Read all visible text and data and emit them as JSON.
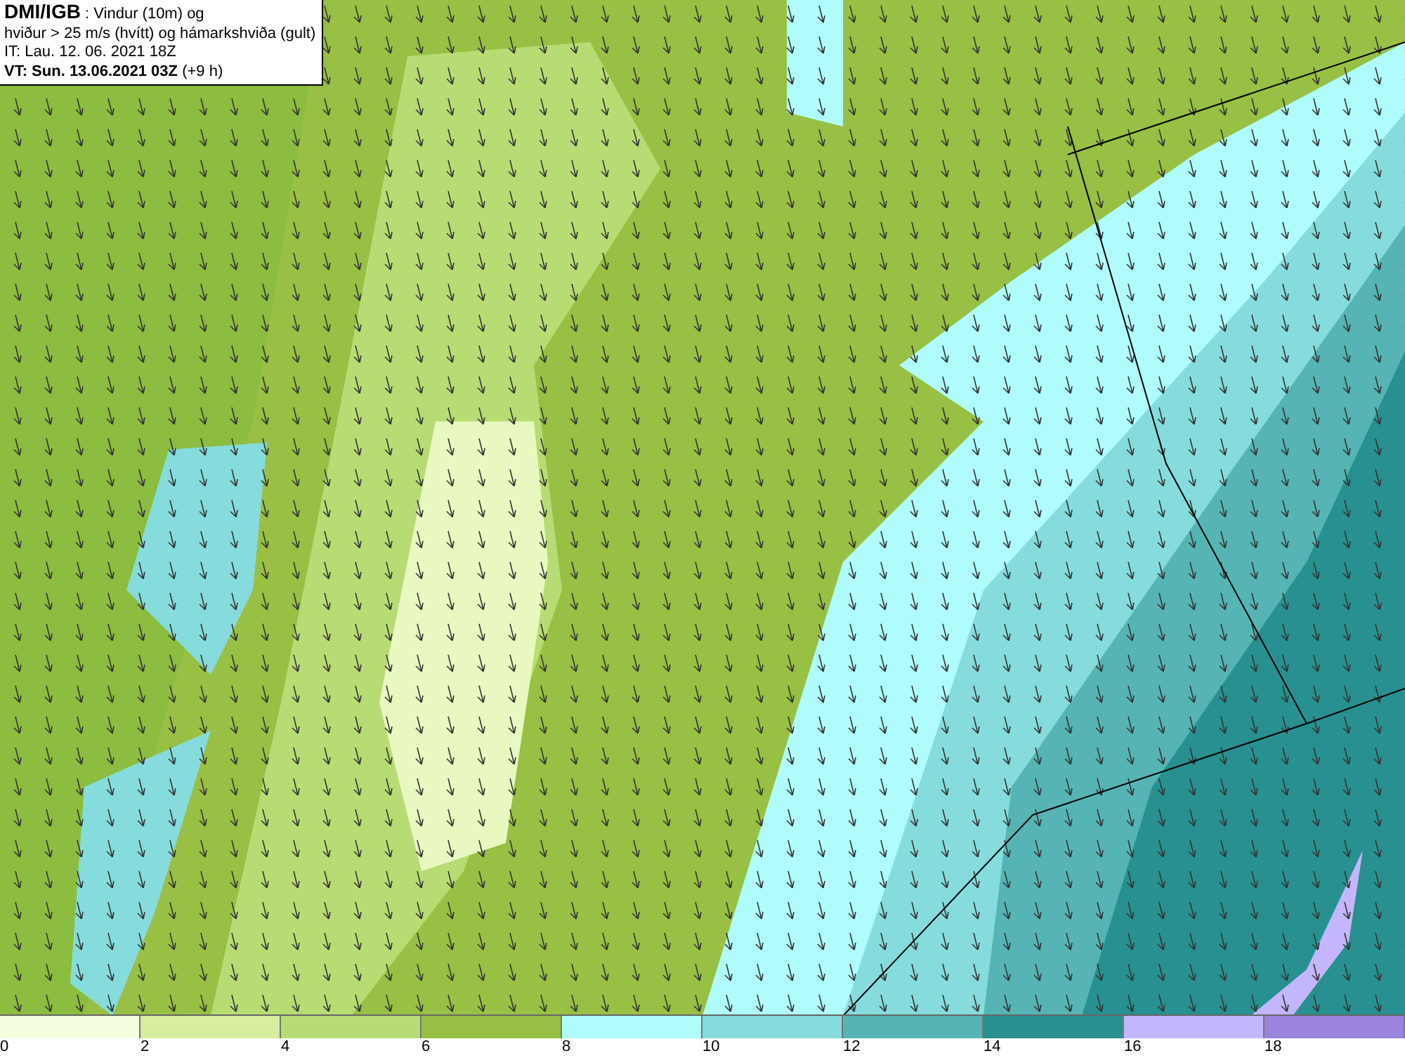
{
  "title_box": {
    "source": "DMI/IGB",
    "description": ": Vindur (10m) og",
    "line_2": "hviður > 25 m/s (hvítt) og hámarkshviða (gult)",
    "issue_time": "IT: Lau. 12. 06. 2021 18Z",
    "valid_time": "VT: Sun. 13.06.2021 03Z",
    "lead": "(+9 h)"
  },
  "legend": {
    "bins": [
      {
        "label": "0",
        "color": "#f4fde0"
      },
      {
        "label": "2",
        "color": "#d6ee9e"
      },
      {
        "label": "4",
        "color": "#b8dc74"
      },
      {
        "label": "6",
        "color": "#98c044"
      },
      {
        "label": "8",
        "color": "#b0fcfc"
      },
      {
        "label": "10",
        "color": "#86dcdc"
      },
      {
        "label": "12",
        "color": "#56b4b4"
      },
      {
        "label": "14",
        "color": "#289090"
      },
      {
        "label": "16",
        "color": "#c4b6fc"
      },
      {
        "label": "18",
        "color": "#9a84dc"
      }
    ]
  }
}
